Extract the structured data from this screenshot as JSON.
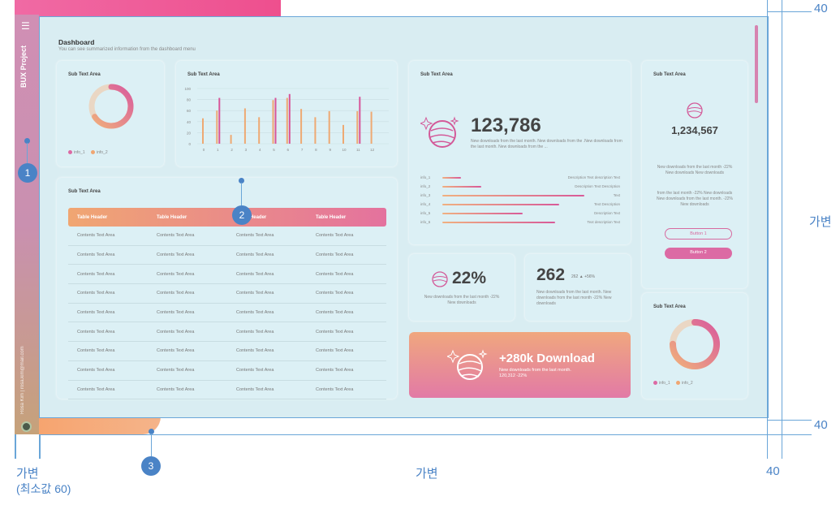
{
  "sidebar": {
    "project": "BUX Project",
    "email": "Rosa Kim | rosa.kim@mail.com"
  },
  "header": {
    "title": "Dashboard",
    "subtitle": "You can see summarized information from the dashboard menu"
  },
  "card_title": "Sub Text Area",
  "legend": {
    "info1": "info_1",
    "info2": "info_2"
  },
  "bar_chart": {
    "type": "bar",
    "categories": [
      "0",
      "1",
      "2",
      "3",
      "4",
      "5",
      "6",
      "7",
      "8",
      "9",
      "10",
      "11",
      "12"
    ],
    "series": [
      {
        "name": "info_1",
        "values": [
          null,
          83,
          null,
          null,
          null,
          83,
          90,
          null,
          null,
          null,
          null,
          85,
          null
        ]
      },
      {
        "name": "info_2",
        "values": [
          46,
          60,
          16,
          64,
          48,
          79,
          83,
          63,
          48,
          59,
          34,
          59,
          58
        ]
      }
    ],
    "yticks": [
      "0",
      "20",
      "40",
      "60",
      "80",
      "100"
    ],
    "ylim": [
      0,
      100
    ]
  },
  "table": {
    "headers": [
      "Table Header",
      "Table Header",
      "Table Header",
      "Table Header"
    ],
    "cell": "Contents Text Area",
    "rows": 9
  },
  "stat1": {
    "value": "123,786",
    "desc": "New downloads from the last month. New downloads from the .New downloads from the last month. New downloads from the ...",
    "items": [
      {
        "label": "info_1",
        "right": "Description Text description Text",
        "pct": 0.12
      },
      {
        "label": "info_2",
        "right": "Description Text Description",
        "pct": 0.25
      },
      {
        "label": "info_3",
        "right": "Text",
        "pct": 0.92
      },
      {
        "label": "info_4",
        "right": "Text Description",
        "pct": 0.76
      },
      {
        "label": "info_5",
        "right": "Description Text",
        "pct": 0.52
      },
      {
        "label": "info_6",
        "right": "Text description Text",
        "pct": 0.73
      }
    ]
  },
  "stat2": {
    "value": "1,234,567",
    "desc1": "New downloads from the last month -22% New downloads New downloads",
    "desc2": "from the last month -22% New downloads New downloads from the last month. -22% New downloads",
    "button1": "Button 1",
    "button2": "Button 2"
  },
  "stat3": {
    "value": "22%",
    "desc": "New downloads from the last month -22% New downloads"
  },
  "stat4": {
    "value": "262",
    "small": "262 ▲ +56%",
    "desc": "New downloads from the last month. New downloads from the last month -22% New downloads"
  },
  "download": {
    "title": "+280k Download",
    "desc1": "New downloads from the last month.",
    "desc2": "120,312 -22%"
  },
  "donut1_pct": 0.66,
  "donut2_pct": 0.75,
  "colors": {
    "accent": "#dc6aa4",
    "accent2": "#f0a672",
    "annotation": "#4a83c6"
  },
  "annotations": {
    "n1": "1",
    "n2": "2",
    "n3": "3",
    "variable": "가변",
    "variable_min": "(최소값 60)",
    "forty": "40"
  }
}
